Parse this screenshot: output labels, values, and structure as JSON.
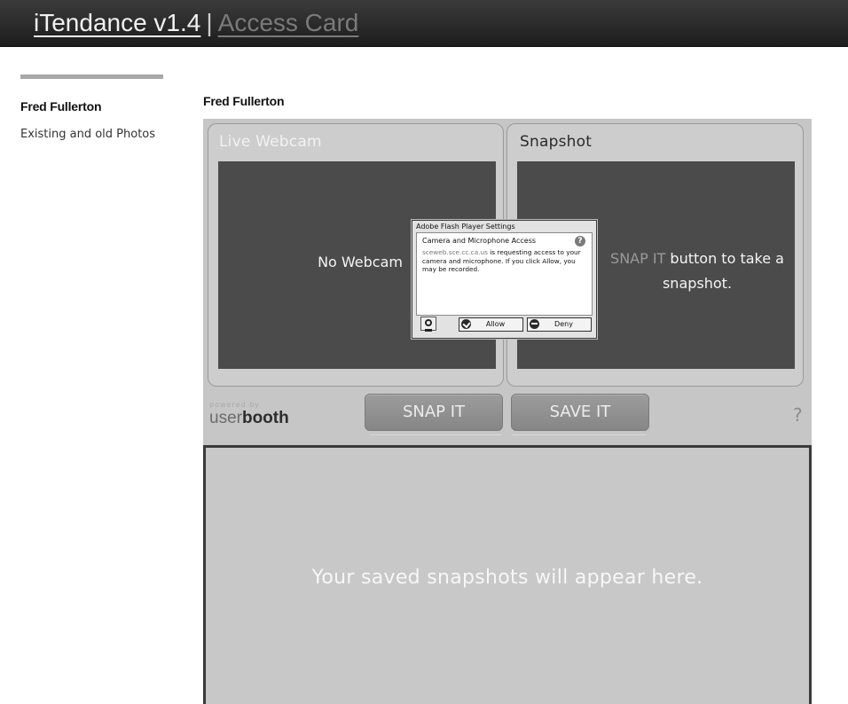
{
  "header": {
    "app_title": "iTendance v1.4",
    "separator": "|",
    "page_name": "Access Card"
  },
  "sidebar": {
    "name": "Fred Fullerton",
    "link": "Existing and old Photos"
  },
  "main": {
    "name": "Fred Fullerton"
  },
  "booth": {
    "live_label": "Live Webcam",
    "no_webcam": "No Webcam",
    "snapshot_label": "Snapshot",
    "snap_hint_highlight": "SNAP IT",
    "snap_hint_rest": " button to take a snapshot.",
    "powered_by": "powered by",
    "brand_user": "user",
    "brand_booth": "booth",
    "snap_button": "SNAP IT",
    "save_button": "SAVE IT",
    "help": "?",
    "gallery_text": "Your saved snapshots will appear here."
  },
  "flash_dialog": {
    "title": "Adobe Flash Player Settings",
    "heading": "Camera and Microphone Access",
    "domain": "sceweb.sce.cc.ca.us",
    "message": " is requesting access to your camera and microphone. If you click Allow, you may be recorded.",
    "help": "?",
    "allow_label": "Allow",
    "deny_label": "Deny"
  }
}
